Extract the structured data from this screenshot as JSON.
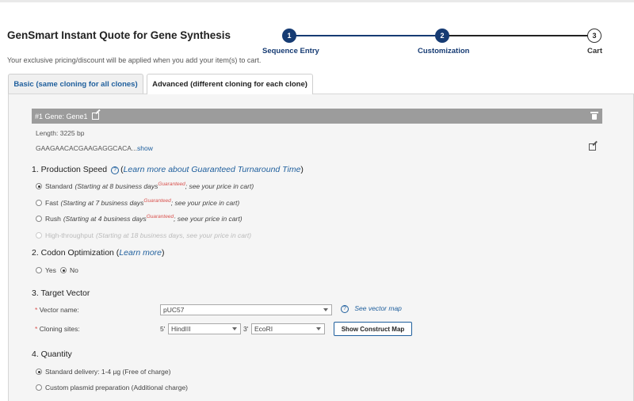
{
  "header": {
    "title": "GenSmart Instant Quote for Gene Synthesis",
    "subtitle": "Your exclusive pricing/discount will be applied when you add your item(s) to cart."
  },
  "stepper": [
    {
      "number": "1",
      "label": "Sequence Entry",
      "state": "done"
    },
    {
      "number": "2",
      "label": "Customization",
      "state": "current"
    },
    {
      "number": "3",
      "label": "Cart",
      "state": "todo"
    }
  ],
  "tabs": {
    "basic": "Basic (same cloning for all clones)",
    "advanced": "Advanced (different cloning for each clone)"
  },
  "gene": {
    "title": "#1 Gene: Gene1",
    "length": "Length: 3225 bp",
    "sequence": "GAAGAACACGAAGAGGCACA...",
    "show_link": "show"
  },
  "production": {
    "title": "1. Production Speed",
    "help_link": "Learn more about Guaranteed Turnaround Time",
    "options": [
      {
        "label": "Standard",
        "note_pre": "(Starting at 8 business days",
        "sup": "Guaranteed",
        "note_post": "; see your price in cart)",
        "selected": true,
        "disabled": false
      },
      {
        "label": "Fast",
        "note_pre": "(Starting at 7 business days",
        "sup": "Guaranteed",
        "note_post": "; see your price in cart)",
        "selected": false,
        "disabled": false
      },
      {
        "label": "Rush",
        "note_pre": "(Starting at 4 business days",
        "sup": "Guaranteed",
        "note_post": "; see your price in cart)",
        "selected": false,
        "disabled": false
      },
      {
        "label": "High-throughput",
        "note_pre": "(Starting at 18 business days, see your price in cart)",
        "sup": "",
        "note_post": "",
        "selected": false,
        "disabled": true
      }
    ]
  },
  "codon": {
    "title": "2. Codon Optimization",
    "help_link": "Learn more",
    "yes": "Yes",
    "no": "No",
    "selected": "No"
  },
  "vector": {
    "title": "3. Target Vector",
    "vector_name_label": "Vector name:",
    "vector_name_value": "pUC57",
    "see_map_link": "See vector map",
    "cloning_sites_label": "Cloning sites:",
    "prefix5": "5'",
    "site5": "HindIII",
    "prefix3": "3'",
    "site3": "EcoRI",
    "show_map_button": "Show Construct Map"
  },
  "quantity": {
    "title": "4. Quantity",
    "options": [
      {
        "label": "Standard delivery: 1-4 µg (Free of charge)",
        "selected": true
      },
      {
        "label": "Custom plasmid preparation (Additional charge)",
        "selected": false
      }
    ]
  },
  "colors": {
    "accent": "#163b73",
    "link": "#1f5f9d",
    "required": "#d9534f",
    "gene_bar": "#9c9c9c"
  }
}
